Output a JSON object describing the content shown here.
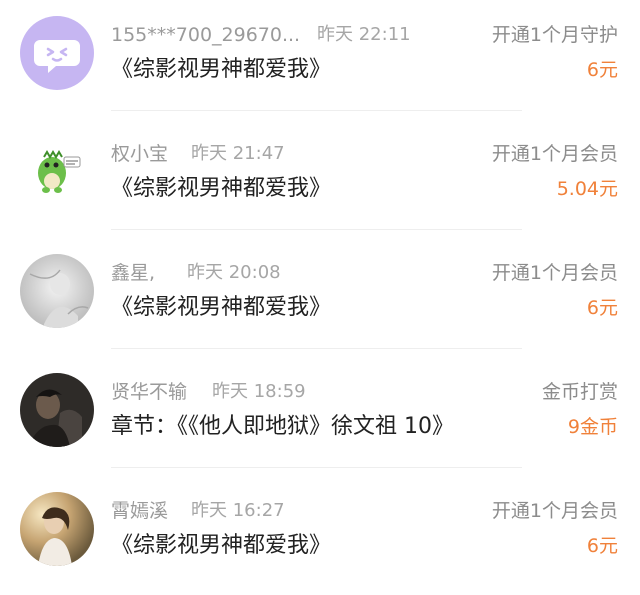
{
  "items": [
    {
      "name": "155***700_29670...",
      "time": "昨天 22:11",
      "title": "《综影视男神都爱我》",
      "action": "开通1个月守护",
      "price": "6元",
      "avatar_icon": "purple-chat-bubble-icon",
      "avatar_color": "#c6b6f2"
    },
    {
      "name": "权小宝",
      "time": "昨天 21:47",
      "title": "《综影视男神都爱我》",
      "action": "开通1个月会员",
      "price": "5.04元",
      "avatar_icon": "green-dinosaur-sticker-icon",
      "avatar_color": "#6cbf4a"
    },
    {
      "name": "鑫星,",
      "time": "昨天 20:08",
      "title": "《综影视男神都爱我》",
      "action": "开通1个月会员",
      "price": "6元",
      "avatar_icon": "grey-photo-avatar-icon",
      "avatar_color": "#d6d6d6"
    },
    {
      "name": "贤华不输",
      "time": "昨天 18:59",
      "title": "章节：《《他人即地狱》徐文祖 10》",
      "action": "金币打赏",
      "price": "9金币",
      "avatar_icon": "dark-photo-avatar-icon",
      "avatar_color": "#3a3632"
    },
    {
      "name": "霄嫣溪",
      "time": "昨天 16:27",
      "title": "《综影视男神都爱我》",
      "action": "开通1个月会员",
      "price": "6元",
      "avatar_icon": "sunlit-portrait-avatar-icon",
      "avatar_color": "#b89a6e"
    }
  ],
  "colors": {
    "price": "#f0813a",
    "name": "#9a9a9a",
    "title": "#222222",
    "action": "#8c8c8c"
  }
}
